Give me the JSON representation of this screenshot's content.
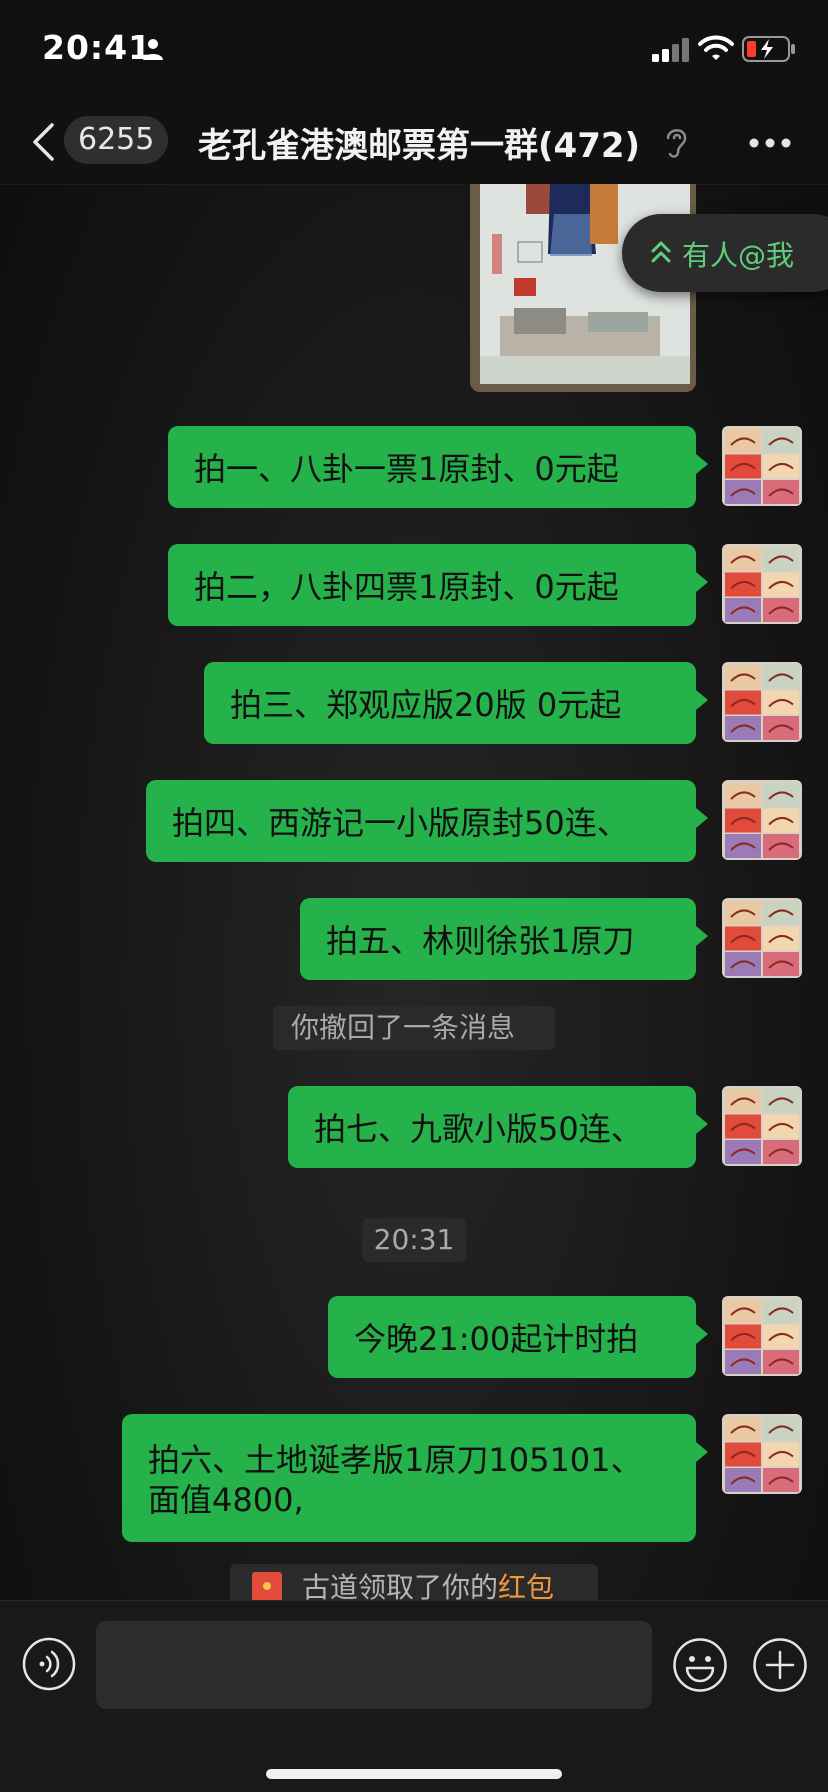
{
  "status_bar": {
    "time": "20:41",
    "icons": [
      "person-icon",
      "signal-icon",
      "wifi-icon",
      "battery-charging-icon"
    ]
  },
  "header": {
    "back_icon": "chevron-left-icon",
    "unread_count": "6255",
    "title": "老孔雀港澳邮票第一群(472)",
    "ear_icon": "ear-icon",
    "more_icon": "more-dots-icon"
  },
  "mention_banner": {
    "label": "有人@我"
  },
  "messages": [
    {
      "text": "拍一、八卦一票1原封、0元起"
    },
    {
      "text": "拍二，八卦四票1原封、0元起"
    },
    {
      "text": "拍三、郑观应版20版 0元起"
    },
    {
      "text": "拍四、西游记一小版原封50连、"
    },
    {
      "text": "拍五、林则徐张1原刀"
    },
    {
      "text": "拍七、九歌小版50连、"
    },
    {
      "text": "今晚21:00起计时拍"
    },
    {
      "text": "拍六、土地诞孝版1原刀105101、面值4800,"
    }
  ],
  "system": {
    "recall": "你撤回了一条消息",
    "timestamp": "20:31"
  },
  "red_packet": {
    "prefix": "古道领取了你的",
    "highlight": "红包"
  },
  "input_bar": {
    "placeholder": ""
  },
  "colors": {
    "bubble": "#25b24a",
    "accent": "#5fcf7b",
    "red_packet_highlight": "#f3963b"
  }
}
